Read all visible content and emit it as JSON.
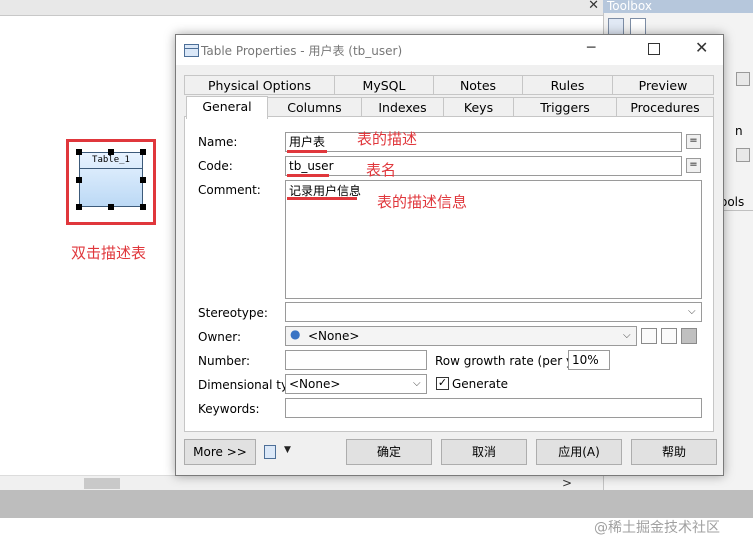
{
  "app": {
    "close_glyph": "✕",
    "scroll_right_glyph": ">"
  },
  "toolbox": {
    "title": "Toolbox",
    "frag_n": "n",
    "frag_ools": "ools"
  },
  "canvas": {
    "table_symbol_name": "Table_1",
    "annotation_double_click": "双击描述表"
  },
  "dialog": {
    "title": "Table Properties - 用户表 (tb_user)",
    "minimize_glyph": "─",
    "close_glyph": "✕",
    "tabs_row1": [
      "Physical Options",
      "MySQL",
      "Notes",
      "Rules",
      "Preview"
    ],
    "tabs_row2": [
      "General",
      "Columns",
      "Indexes",
      "Keys",
      "Triggers",
      "Procedures"
    ],
    "active_tab": "General",
    "fields": {
      "name_label": "Name:",
      "name_value": "用户表",
      "code_label": "Code:",
      "code_value": "tb_user",
      "comment_label": "Comment:",
      "comment_value": "记录用户信息",
      "stereotype_label": "Stereotype:",
      "stereotype_value": "",
      "owner_label": "Owner:",
      "owner_value": "<None>",
      "number_label": "Number:",
      "number_value": "",
      "row_growth_label": "Row growth rate (per year):",
      "row_growth_value": "10%",
      "dimensional_label": "Dimensional type:",
      "dimensional_value": "<None>",
      "generate_label": "Generate",
      "generate_checked": true,
      "keywords_label": "Keywords:",
      "keywords_value": "",
      "eq_glyph": "="
    },
    "annotations": {
      "name_note": "表的描述",
      "code_note": "表名",
      "comment_note": "表的描述信息"
    },
    "buttons": {
      "more": "More >>",
      "ok": "确定",
      "cancel": "取消",
      "apply": "应用(A)",
      "help": "帮助"
    },
    "colors": {
      "annotation_red": "#e0373c"
    }
  },
  "watermark": "@稀土掘金技术社区"
}
